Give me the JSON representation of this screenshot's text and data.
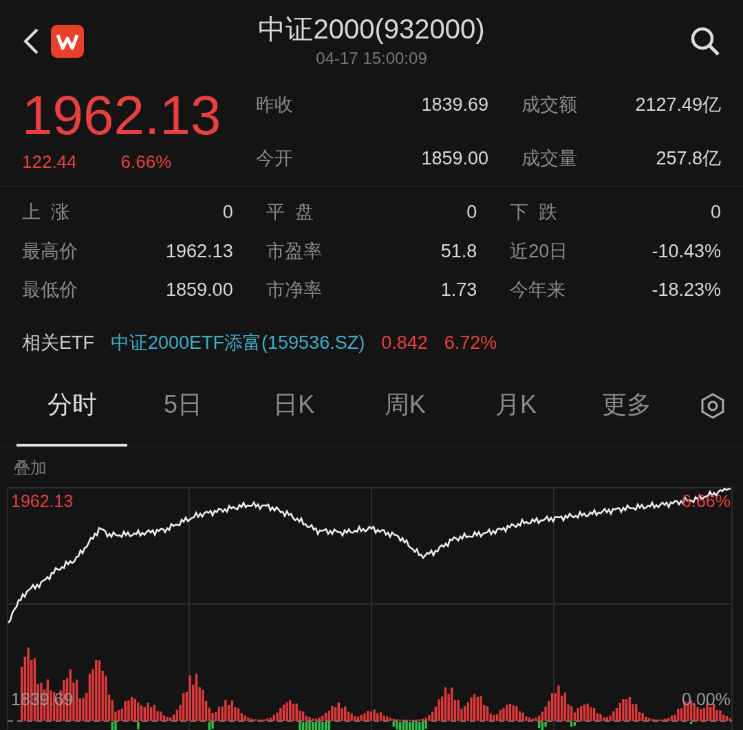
{
  "header": {
    "title": "中证2000(932000)",
    "timestamp": "04-17 15:00:09"
  },
  "quote": {
    "price": "1962.13",
    "change": "122.44",
    "change_percent": "6.66%"
  },
  "summary": [
    {
      "label": "昨收",
      "value": "1839.69"
    },
    {
      "label": "成交额",
      "value": "2127.49亿"
    },
    {
      "label": "今开",
      "value": "1859.00"
    },
    {
      "label": "成交量",
      "value": "257.8亿"
    }
  ],
  "stats": [
    {
      "label": "上  涨",
      "value": "0"
    },
    {
      "label": "平  盘",
      "value": "0"
    },
    {
      "label": "下  跌",
      "value": "0"
    },
    {
      "label": "最高价",
      "value": "1962.13"
    },
    {
      "label": "市盈率",
      "value": "51.8"
    },
    {
      "label": "近20日",
      "value": "-10.43%"
    },
    {
      "label": "最低价",
      "value": "1859.00"
    },
    {
      "label": "市净率",
      "value": "1.73"
    },
    {
      "label": "今年来",
      "value": "-18.23%"
    }
  ],
  "related_etf": {
    "label": "相关ETF",
    "name": "中证2000ETF添富(159536.SZ)",
    "price": "0.842",
    "change_percent": "6.72%"
  },
  "tabs": [
    {
      "label": "分时",
      "selected": true
    },
    {
      "label": "5日",
      "selected": false
    },
    {
      "label": "日K",
      "selected": false
    },
    {
      "label": "周K",
      "selected": false
    },
    {
      "label": "月K",
      "selected": false
    },
    {
      "label": "更多",
      "selected": false
    }
  ],
  "chart": {
    "overlay_label": "叠加",
    "high_label": "1962.13",
    "high_percent": "6.66%",
    "base_label": "1839.69",
    "base_percent": "0.00%"
  }
}
